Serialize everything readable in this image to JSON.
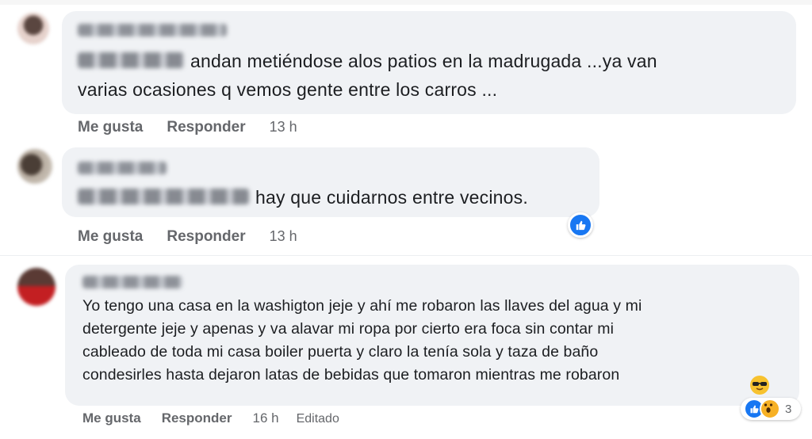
{
  "comments": [
    {
      "text_lines": [
        "andan metiéndose alos patios en la madrugada ...ya van",
        "varias ocasiones q vemos gente entre los carros ..."
      ],
      "actions": {
        "like": "Me gusta",
        "reply": "Responder",
        "time": "13 h"
      }
    },
    {
      "text_lines": [
        "hay que cuidarnos entre vecinos."
      ],
      "actions": {
        "like": "Me gusta",
        "reply": "Responder",
        "time": "13 h"
      },
      "reaction": "like-icon"
    },
    {
      "text_lines": [
        "Yo tengo una casa en la washigton jeje y ahí me robaron las llaves del agua y mi",
        "detergente jeje y apenas y va alavar mi ropa por cierto era foca sin contar mi",
        "cableado de toda mi casa boiler puerta y claro la tenía sola y taza de baño",
        "condesirles hasta dejaron latas de bebidas que tomaron mientras me robaron"
      ],
      "actions": {
        "like": "Me gusta",
        "reply": "Responder",
        "time": "16 h",
        "edited": "Editado"
      },
      "reactions": {
        "icons": [
          "like-icon",
          "wow-icon"
        ],
        "count": "3"
      },
      "trailing_emoji": "sunglasses-emoji"
    }
  ],
  "colors": {
    "bubble": "#f0f2f5",
    "meta_text": "#65676b",
    "body_text": "#1c1e21",
    "like_blue": "#1877f2"
  }
}
